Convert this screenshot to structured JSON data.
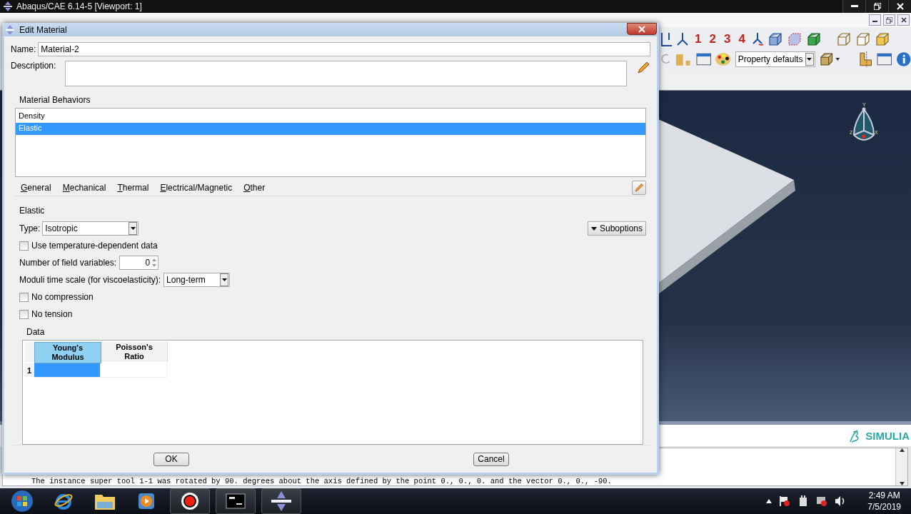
{
  "window": {
    "title": "Abaqus/CAE 6.14-5 [Viewport: 1]"
  },
  "toolbar": {
    "view_numbers": [
      "1",
      "2",
      "3",
      "4"
    ],
    "render_style": "Property defaults"
  },
  "viewport": {
    "triad_labels": [
      "Y",
      "Z",
      "X"
    ]
  },
  "branding": "SIMULIA",
  "message": "The instance super tool 1-1 was rotated by 90. degrees about the axis defined by the point 0., 0., 0. and the vector 0., 0., -90.",
  "dialog": {
    "title": "Edit Material",
    "name_label": "Name:",
    "name": "Material-2",
    "description_label": "Description:",
    "behaviors_title": "Material Behaviors",
    "behaviors": [
      {
        "label": "Density",
        "selected": false
      },
      {
        "label": "Elastic",
        "selected": true
      }
    ],
    "menus": [
      "General",
      "Mechanical",
      "Thermal",
      "Electrical/Magnetic",
      "Other"
    ],
    "section_title": "Elastic",
    "type_label": "Type:",
    "type": "Isotropic",
    "suboptions": "Suboptions",
    "options": [
      {
        "kind": "checkbox",
        "label": "Use temperature-dependent data",
        "checked": false
      },
      {
        "kind": "spinner",
        "label": "Number of field variables:",
        "value": "0"
      },
      {
        "kind": "dropdown",
        "label": "Moduli time scale (for viscoelasticity):",
        "value": "Long-term"
      },
      {
        "kind": "checkbox",
        "label": "No compression",
        "checked": false
      },
      {
        "kind": "checkbox",
        "label": "No tension",
        "checked": false
      }
    ],
    "data_title": "Data",
    "columns": [
      {
        "label": "Young's\nModulus",
        "selected": true
      },
      {
        "label": "Poisson's\nRatio",
        "selected": false
      }
    ],
    "rows": [
      {
        "label": "1"
      }
    ],
    "buttons": [
      "OK",
      "Cancel"
    ]
  },
  "taskbar": {
    "time": "2:49 AM",
    "date": "7/5/2019"
  }
}
